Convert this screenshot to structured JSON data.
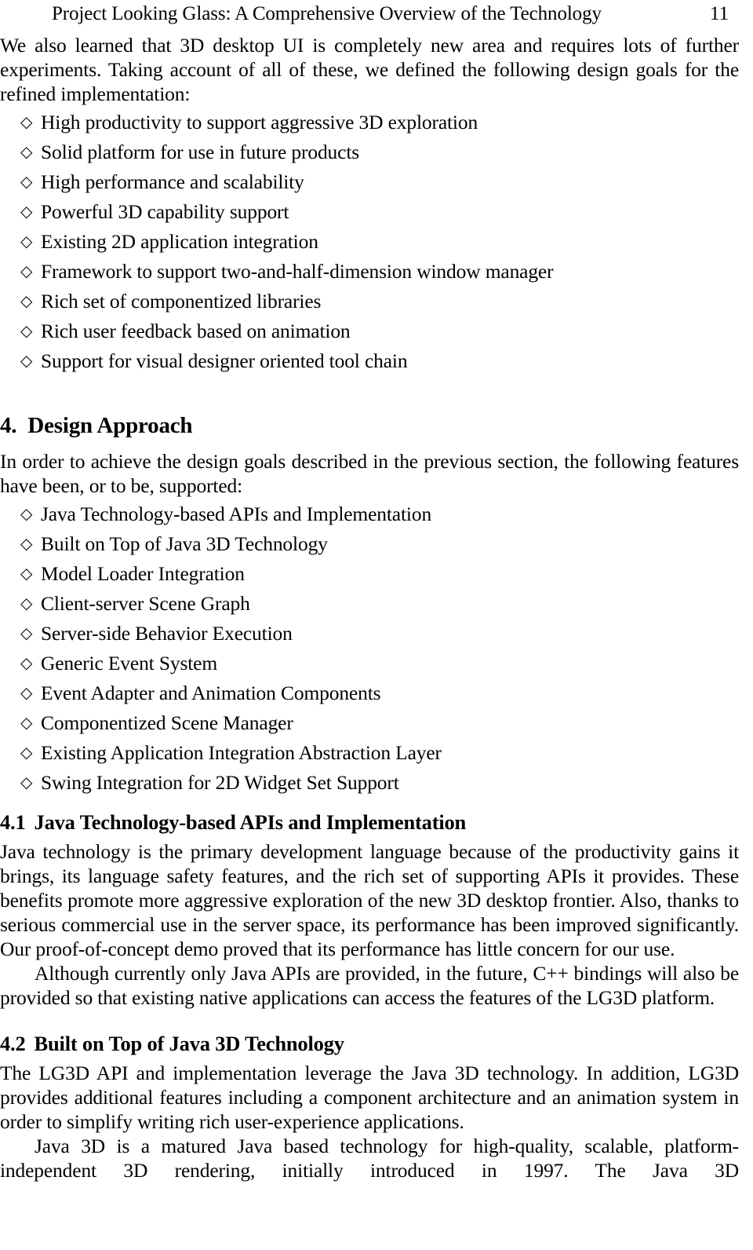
{
  "document": {
    "running_header": {
      "title": "Project Looking Glass: A Comprehensive Overview of the Technology",
      "page_number": "11"
    },
    "bullet_glyph": "◇",
    "intro_paragraph": "We also learned that 3D desktop UI is completely new area and requires lots of further experiments. Taking account of all of these, we defined the following design goals for the refined implementation:",
    "design_goals": [
      "High productivity to support aggressive 3D exploration",
      "Solid platform for use in future products",
      "High performance and scalability",
      "Powerful 3D capability support",
      "Existing 2D application integration",
      "Framework to support two-and-half-dimension window manager",
      "Rich set of componentized libraries",
      "Rich user feedback based on animation",
      "Support for visual designer oriented tool chain"
    ],
    "section_4": {
      "number": "4.",
      "title": "Design Approach",
      "intro_paragraph": "In order to achieve the design goals described in the previous section, the following features have been, or to be, supported:",
      "features": [
        "Java Technology-based APIs and Implementation",
        "Built on Top of Java 3D Technology",
        "Model Loader Integration",
        "Client-server Scene Graph",
        "Server-side Behavior Execution",
        "Generic Event System",
        "Event Adapter and Animation Components",
        "Componentized Scene Manager",
        "Existing Application Integration Abstraction Layer",
        "Swing Integration for 2D Widget Set Support"
      ]
    },
    "section_4_1": {
      "number": "4.1",
      "title": "Java Technology-based APIs and Implementation",
      "paragraph_1": "Java technology is the primary development language because of the productivity gains it brings, its language safety features, and the rich set of supporting APIs it provides. These benefits promote more aggressive exploration of the new 3D desktop frontier. Also, thanks to serious commercial use in the server space, its performance has been improved significantly. Our proof-of-concept demo proved that its performance has little concern for our use.",
      "paragraph_2": "Although currently only Java APIs are provided, in the future, C++ bindings will also be provided so that existing native applications can access the features of the LG3D platform."
    },
    "section_4_2": {
      "number": "4.2",
      "title": "Built on Top of Java 3D Technology",
      "paragraph_1": "The LG3D API and implementation leverage the Java 3D technology. In addition, LG3D provides additional features including a component architecture and an animation system in order to simplify writing rich user-experience applications.",
      "paragraph_2": "Java 3D is a matured Java based technology for high-quality, scalable, platform-independent 3D rendering, initially introduced in 1997. The Java 3D"
    }
  }
}
